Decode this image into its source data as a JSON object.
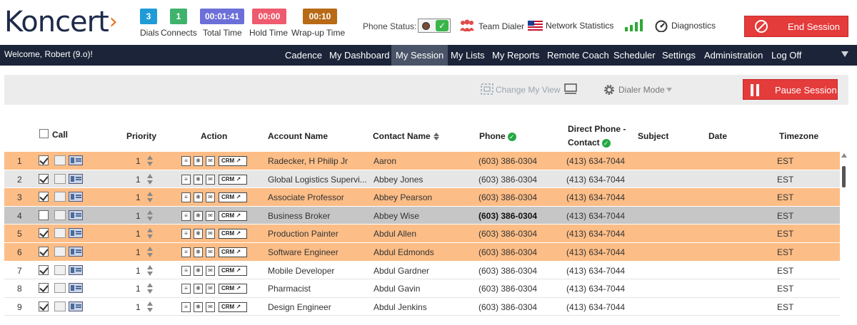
{
  "app": {
    "logo_text": "Koncert",
    "logo_mark": "›"
  },
  "stats": [
    {
      "value": "3",
      "label": "Dials",
      "color": "#1f9bd7"
    },
    {
      "value": "1",
      "label": "Connects",
      "color": "#3fb36b"
    },
    {
      "value": "00:01:41",
      "label": "Total Time",
      "color": "#6c6fd8"
    },
    {
      "value": "00:00",
      "label": "Hold Time",
      "color": "#ee5a6e"
    },
    {
      "value": "00:10",
      "label": "Wrap-up Time",
      "color": "#b86a16"
    }
  ],
  "phone_status": {
    "label": "Phone Status:",
    "ok_glyph": "✓"
  },
  "header_links": {
    "team_dialer": "Team Dialer",
    "network_statistics": "Network Statistics",
    "diagnostics": "Diagnostics"
  },
  "end_session": "End Session",
  "navbar": {
    "welcome": "Welcome, Robert (9.o)!",
    "items": [
      "Cadence",
      "My Dashboard",
      "My Session",
      "My Lists",
      "My Reports",
      "Remote Coach",
      "Scheduler",
      "Settings",
      "Administration",
      "Log Off"
    ],
    "active": "My Session"
  },
  "toolbar": {
    "change_my_view": "Change My View",
    "dialer_mode": "Dialer Mode",
    "pause_session": "Pause Session"
  },
  "table": {
    "columns": {
      "call": "Call",
      "priority": "Priority",
      "action": "Action",
      "account_name": "Account Name",
      "contact_name": "Contact Name",
      "phone": "Phone",
      "direct_phone_1": "Direct Phone -",
      "direct_phone_2": "Contact",
      "subject": "Subject",
      "date": "Date",
      "timezone": "Timezone"
    },
    "crm_label": "CRM ↗",
    "rows": [
      {
        "num": "1",
        "checked": true,
        "priority": "1",
        "account": "Radecker, H Philip Jr",
        "contact": "Aaron",
        "phone": "(603) 386-0304",
        "direct": "(413) 634-7044",
        "tz": "EST",
        "style": "orange"
      },
      {
        "num": "2",
        "checked": true,
        "priority": "1",
        "account": "Global Logistics Supervi...",
        "contact": "Abbey Jones",
        "phone": "(603) 386-0304",
        "direct": "(413) 634-7044",
        "tz": "EST",
        "style": "lightgray"
      },
      {
        "num": "3",
        "checked": true,
        "priority": "1",
        "account": "Associate Professor",
        "contact": "Abbey Pearson",
        "phone": "(603) 386-0304",
        "direct": "(413) 634-7044",
        "tz": "EST",
        "style": "orange"
      },
      {
        "num": "4",
        "checked": false,
        "priority": "1",
        "account": "Business Broker",
        "contact": "Abbey Wise",
        "phone": "(603) 386-0304",
        "direct": "(413) 634-7044",
        "tz": "EST",
        "style": "midgray",
        "phone_bold": true
      },
      {
        "num": "5",
        "checked": true,
        "priority": "1",
        "account": "Production Painter",
        "contact": "Abdul Allen",
        "phone": "(603) 386-0304",
        "direct": "(413) 634-7044",
        "tz": "EST",
        "style": "orange"
      },
      {
        "num": "6",
        "checked": true,
        "priority": "1",
        "account": "Software Engineer",
        "contact": "Abdul Edmonds",
        "phone": "(603) 386-0304",
        "direct": "(413) 634-7044",
        "tz": "EST",
        "style": "orange"
      },
      {
        "num": "7",
        "checked": true,
        "priority": "1",
        "account": "Mobile Developer",
        "contact": "Abdul Gardner",
        "phone": "(603) 386-0304",
        "direct": "(413) 634-7044",
        "tz": "EST",
        "style": "white"
      },
      {
        "num": "8",
        "checked": true,
        "priority": "1",
        "account": "Pharmacist",
        "contact": "Abdul Gavin",
        "phone": "(603) 386-0304",
        "direct": "(413) 634-7044",
        "tz": "EST",
        "style": "white"
      },
      {
        "num": "9",
        "checked": true,
        "priority": "1",
        "account": "Design Engineer",
        "contact": "Abdul Jenkins",
        "phone": "(603) 386-0304",
        "direct": "(413) 634-7044",
        "tz": "EST",
        "style": "white"
      }
    ]
  }
}
